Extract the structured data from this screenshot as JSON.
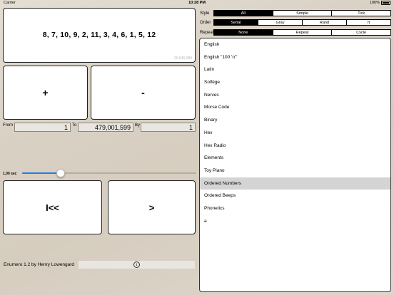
{
  "status": {
    "carrier": "Carrier",
    "time": "10:28 PM",
    "battery": "100%"
  },
  "display": {
    "sequence": "8, 7, 10, 9, 2, 11, 3, 4, 6, 1, 5, 12",
    "count": "20,646,089"
  },
  "buttons": {
    "plus": "+",
    "minus": "-",
    "rewind": "I<<",
    "play": ">"
  },
  "range": {
    "from_label": "From",
    "from_value": "1",
    "to_label": "To",
    "to_value": "479,001,599",
    "by_label": "By",
    "by_value": "1"
  },
  "speed": {
    "label": "1.00 sec",
    "level_fraction": 0.22
  },
  "footer": {
    "credit": "Enumero 1.2 by Henry Lowengard",
    "info_icon": "i"
  },
  "options": {
    "style": {
      "label": "Style",
      "segments": [
        "All",
        "Simple",
        "Tick"
      ],
      "selected": "All"
    },
    "order": {
      "label": "Order",
      "segments": [
        "Serial",
        "Gray",
        "Rand",
        "π"
      ],
      "selected": "Serial"
    },
    "repeat": {
      "label": "Repeat",
      "segments": [
        "None",
        "Repeat",
        "Cycle"
      ],
      "selected": "None"
    }
  },
  "languages": {
    "items": [
      "English",
      "English \"100 'n'\"",
      "Latin",
      "Solfège",
      "Nerves",
      "Morse Code",
      "Binary",
      "Hex",
      "Hex Radio",
      "Elements",
      "Toy Piano",
      "Ordered Numbers",
      "Ordered Beeps",
      "Phonetics",
      "ə"
    ],
    "selected": "Ordered Numbers"
  }
}
